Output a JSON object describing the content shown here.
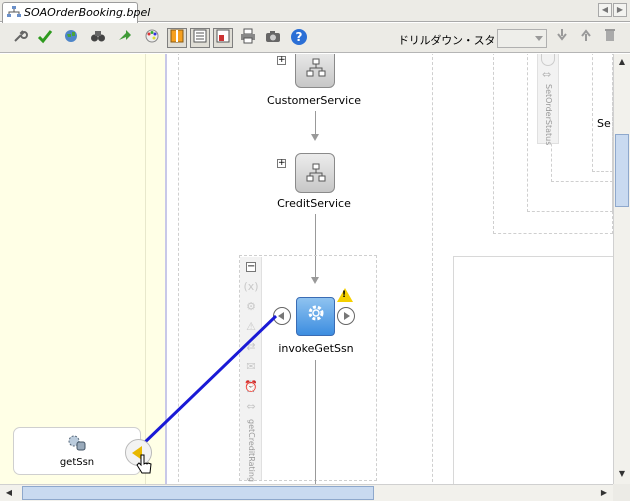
{
  "tab": {
    "title": "SOAOrderBooking.bpel"
  },
  "toolbar": {
    "icons": [
      "wrench-icon",
      "validate-check-icon",
      "globe-icon",
      "binoculars-icon",
      "deploy-arrow-icon",
      "palette-icon",
      "layout-vertical-icon",
      "layout-list-icon",
      "layout-page-icon",
      "print-icon",
      "camera-icon",
      "help-icon"
    ],
    "drilldown_label": "ドリルダウン・スタック:",
    "drilldown_value": "",
    "help_glyph": "?"
  },
  "canvas": {
    "nodes": [
      {
        "label": "CustomerService"
      },
      {
        "label": "CreditService"
      },
      {
        "label": "invokeGetSsn"
      }
    ],
    "scope_vertical_label": "getCreditRating",
    "right_scope_vertical_label": "SetOrderStatus",
    "right_scope_partial_label": "Se",
    "partner_link": {
      "label": "getSsn"
    },
    "expand_glyph": "+",
    "collapse_glyph": "−",
    "variable_glyph": "(x)",
    "warning_glyph": "!"
  },
  "colors": {
    "partner_lane": "#ffffe6",
    "invoke_fill": "#4a98e4",
    "connector": "#1a1ad6",
    "warning": "#f5d000"
  }
}
